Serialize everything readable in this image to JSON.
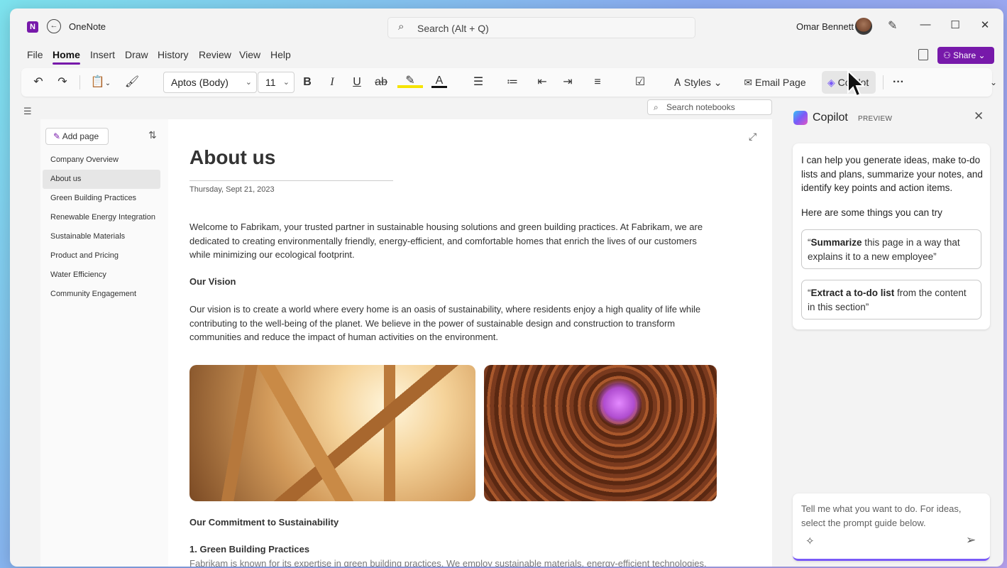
{
  "titlebar": {
    "app_logo": "N",
    "app_name": "OneNote",
    "search_placeholder": "Search (Alt + Q)",
    "user_name": "Omar Bennett"
  },
  "menubar": {
    "items": [
      "File",
      "Home",
      "Insert",
      "Draw",
      "History",
      "Review",
      "View",
      "Help"
    ],
    "active": "Home",
    "share_label": "Share"
  },
  "ribbon": {
    "font_name": "Aptos (Body)",
    "font_size": "11",
    "bold": "B",
    "italic": "I",
    "underline": "U",
    "strike": "ab",
    "font_color": "A",
    "styles_label": "Styles",
    "email_page_label": "Email Page",
    "copilot_label": "Copilot",
    "more_label": "···"
  },
  "notebook": {
    "search_placeholder": "Search notebooks",
    "add_page_label": "Add page",
    "pages": [
      "Company Overview",
      "About us",
      "Green Building Practices",
      "Renewable Energy Integration",
      "Sustainable Materials",
      "Product and Pricing",
      "Water Efficiency",
      "Community Engagement"
    ],
    "selected_page": "About us"
  },
  "page": {
    "title": "About us",
    "date": "Thursday, Sept 21, 2023",
    "intro": "Welcome to Fabrikam, your trusted partner in sustainable housing solutions and green building practices. At Fabrikam, we are dedicated to creating environmentally friendly, energy-efficient, and comfortable homes that enrich the lives of our customers while minimizing our ecological footprint.",
    "vision_heading": "Our Vision",
    "vision_text": "Our vision is to create a world where every home is an oasis of sustainability, where residents enjoy a high quality of life while contributing to the well-being of the planet. We believe in the power of sustainable design and construction to transform communities and reduce the impact of human activities on the environment.",
    "commitment_heading": "Our Commitment to Sustainability",
    "practice_heading": "1. Green Building Practices",
    "practice_text": "Fabrikam is known for its expertise in green building practices. We employ sustainable materials, energy-efficient technologies,"
  },
  "copilot": {
    "title": "Copilot",
    "badge": "PREVIEW",
    "intro": "I can help you generate ideas, make to-do lists and plans, summarize your notes, and identify key points and action items.",
    "try_label": "Here are some things you can try",
    "suggestion_1_bold": "Summarize",
    "suggestion_1_rest": " this page in a way that explains it to a new employee”",
    "suggestion_2_bold": "Extract a to-do list",
    "suggestion_2_rest": " from the content in this section”",
    "input_placeholder": "Tell me what you want to do. For ideas, select the prompt guide below."
  },
  "colors": {
    "accent": "#7719aa",
    "copilot_accent": "#7a5af8"
  }
}
